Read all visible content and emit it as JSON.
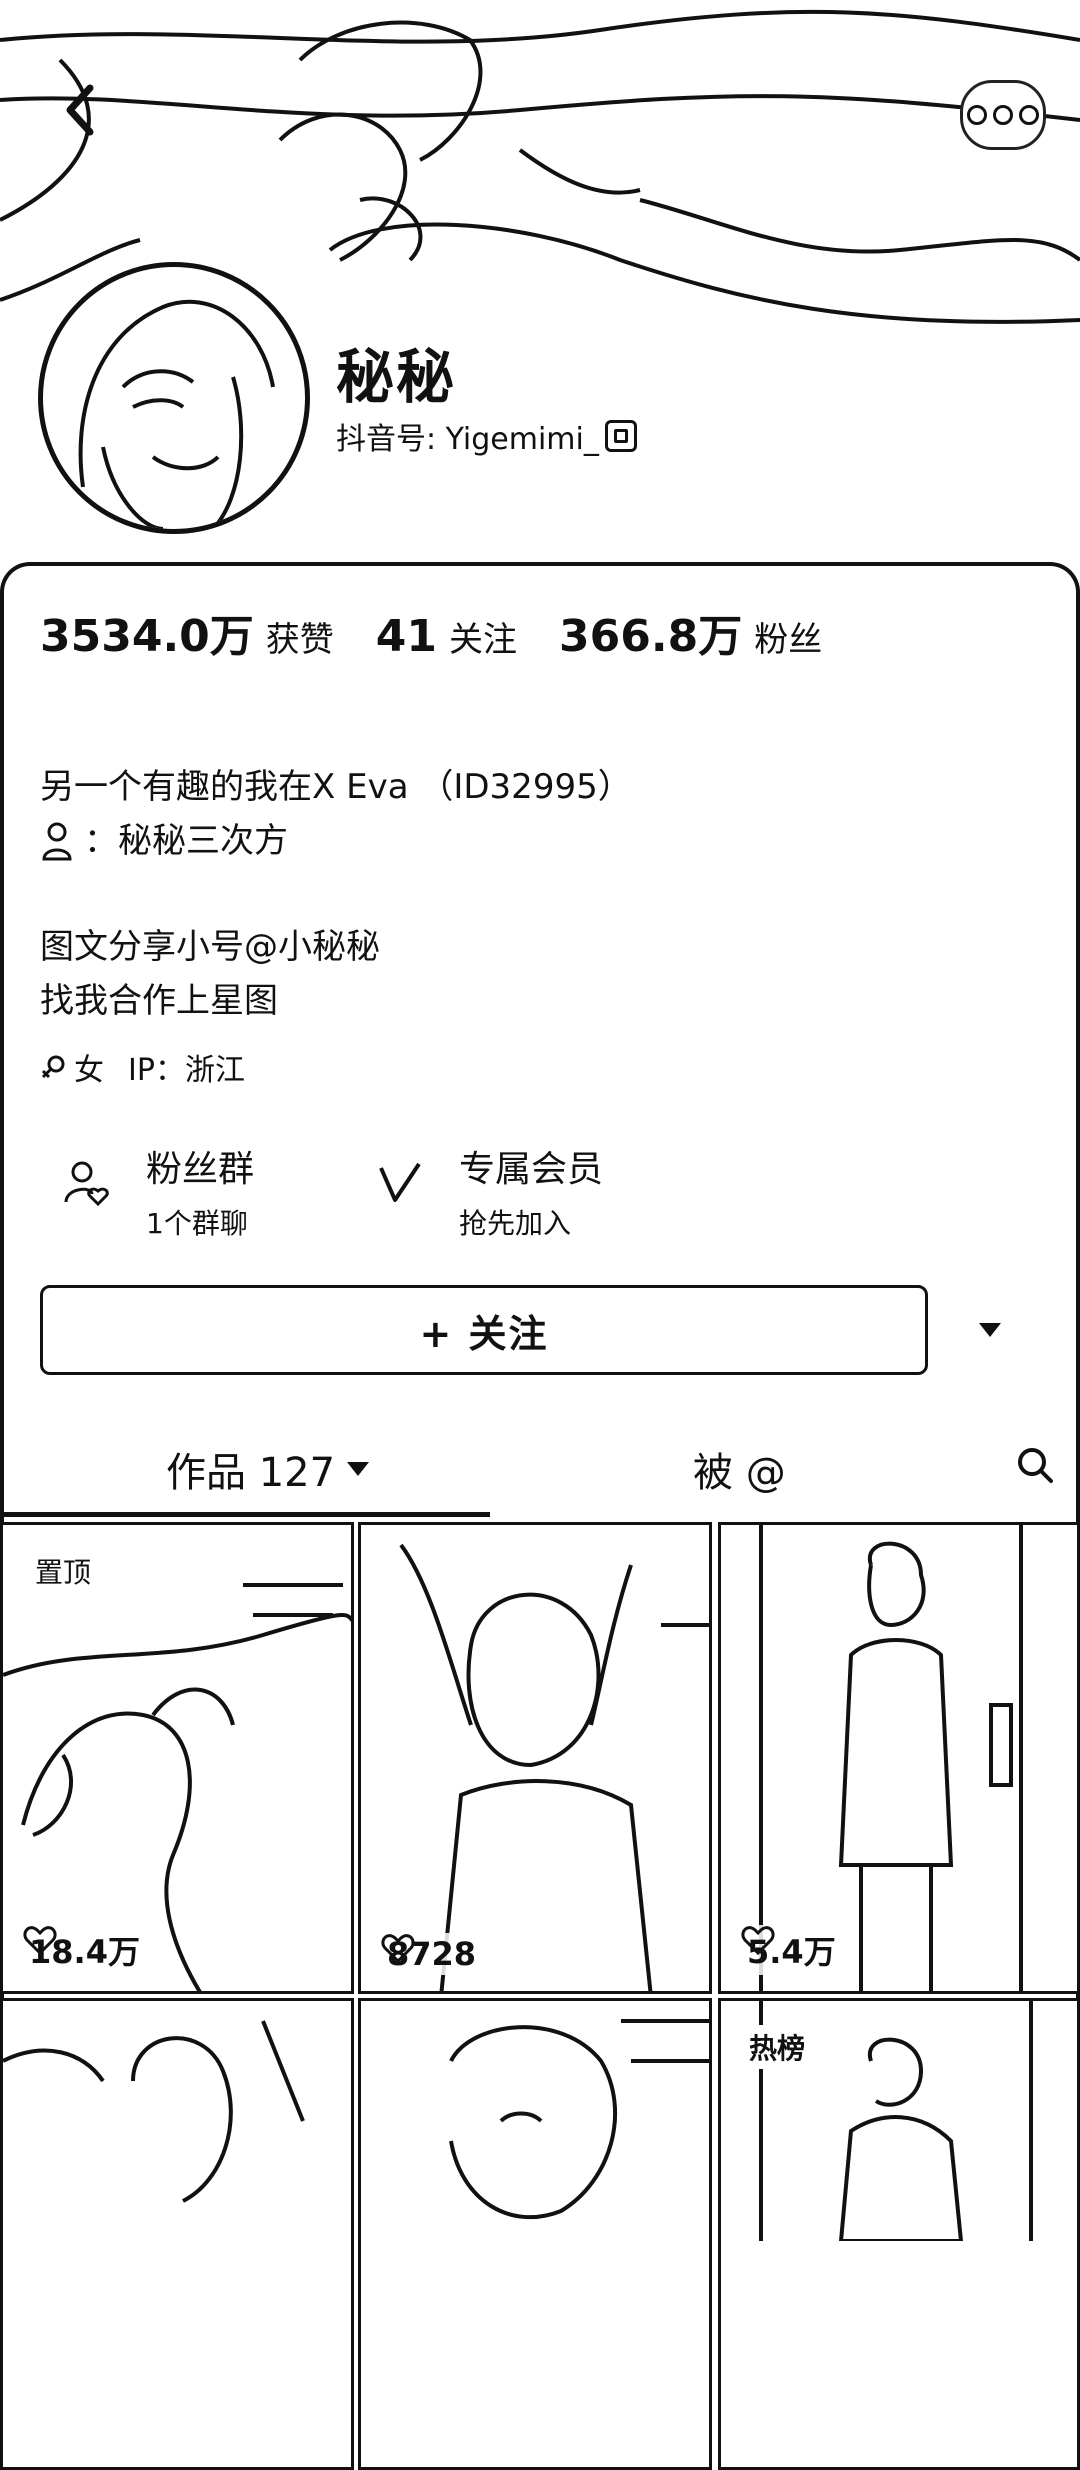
{
  "header": {
    "name": "秘秘",
    "douyin_id": "抖音号: Yigemimi_"
  },
  "stats": [
    {
      "value": "3534.0万",
      "label": "获赞"
    },
    {
      "value": "41",
      "label": "关注"
    },
    {
      "value": "366.8万",
      "label": "粉丝"
    }
  ],
  "bio": {
    "line1": "另一个有趣的我在X Eva （ID32995）",
    "line2": "：秘秘三次方",
    "line3": "图文分享小号@小秘秘",
    "line4": "找我合作上星图"
  },
  "tags": {
    "gender": "女",
    "ip": "IP：浙江"
  },
  "features": [
    {
      "title": "粉丝群",
      "subtitle": "1个群聊",
      "icon": "fans-group-icon"
    },
    {
      "title": "专属会员",
      "subtitle": "抢先加入",
      "icon": "vip-icon"
    }
  ],
  "actions": {
    "follow_label": "+ 关注"
  },
  "tabs": {
    "works_label": "作品 127",
    "mentions_label": "被 @"
  },
  "grid": {
    "items": [
      {
        "badge": "置顶",
        "likes": "18.4万"
      },
      {
        "badge": "",
        "likes": "8728"
      },
      {
        "badge": "",
        "likes": "5.4万"
      },
      {
        "badge": "",
        "likes": ""
      },
      {
        "badge": "",
        "likes": ""
      },
      {
        "badge": "热榜",
        "likes": ""
      }
    ]
  }
}
